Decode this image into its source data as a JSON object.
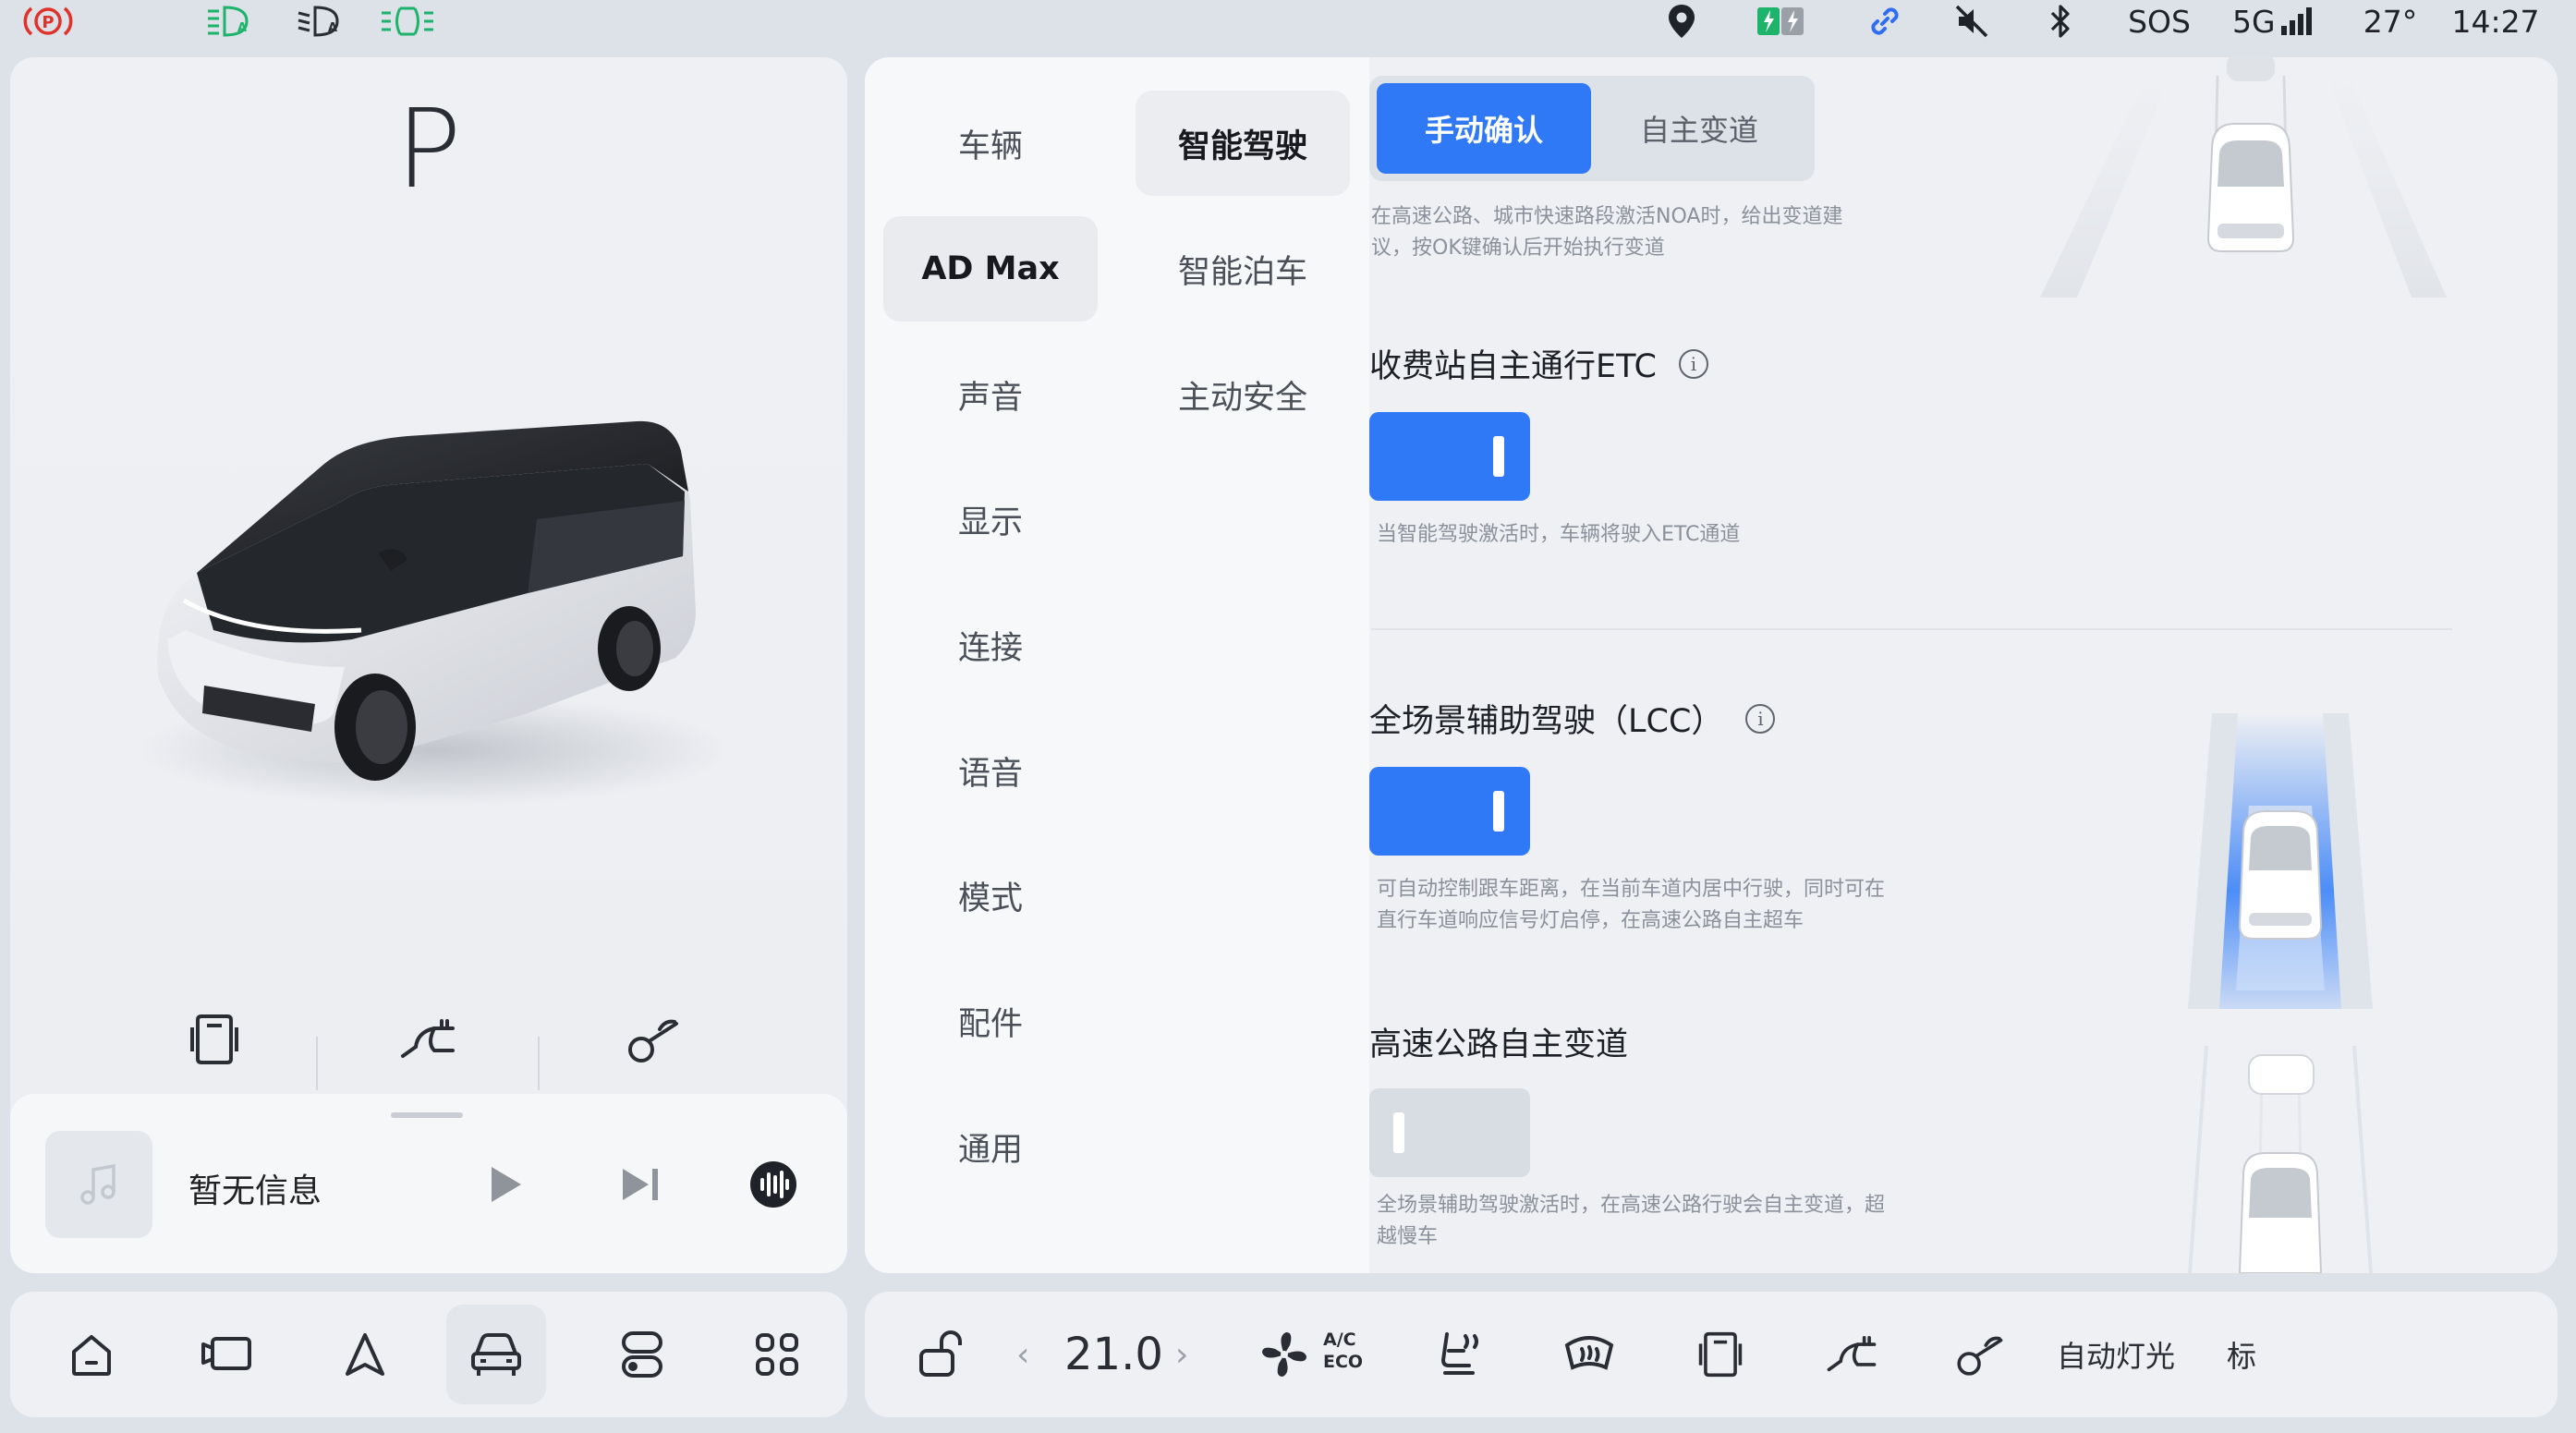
{
  "status_bar": {
    "sos": "SOS",
    "network": "5G",
    "temperature": "27°",
    "time": "14:27"
  },
  "vehicle": {
    "gear": "P"
  },
  "media": {
    "title": "暂无信息"
  },
  "menu": {
    "primary": [
      "车辆",
      "AD Max",
      "声音",
      "显示",
      "连接",
      "语音",
      "模式",
      "配件",
      "通用"
    ],
    "secondary": [
      "智能驾驶",
      "智能泊车",
      "主动安全"
    ]
  },
  "content": {
    "lane_change_mode": {
      "options": [
        "手动确认",
        "自主变道"
      ],
      "selected": "手动确认",
      "description_lines": [
        "在高速公路、城市快速路段激活NOA时，给出变道建",
        "议，按OK键确认后开始执行变道"
      ]
    },
    "etc": {
      "title": "收费站自主通行ETC",
      "enabled": true,
      "description": "当智能驾驶激活时，车辆将驶入ETC通道"
    },
    "lcc": {
      "title": "全场景辅助驾驶（LCC）",
      "enabled": true,
      "description_lines": [
        "可自动控制跟车距离，在当前车道内居中行驶，同时可在",
        "直行车道响应信号灯启停，在高速公路自主超车"
      ]
    },
    "highway_lane_change": {
      "title": "高速公路自主变道",
      "enabled": false,
      "description_lines": [
        "全场景辅助驾驶激活时，在高速公路行驶会自主变道，超",
        "越慢车"
      ]
    }
  },
  "dock": {
    "temperature": "21.0",
    "ac_label": "A/C",
    "eco_label": "ECO",
    "auto_light": "自动灯光",
    "truncated_label": "标"
  },
  "colors": {
    "accent": "#2f79f6",
    "status_green": "#1db36b",
    "status_red": "#e0322b",
    "link_blue": "#2f6cf0"
  }
}
